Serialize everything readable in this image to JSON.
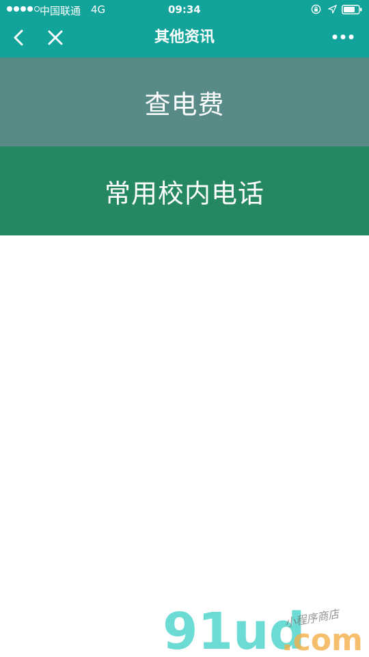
{
  "status_bar": {
    "carrier": "中国联通",
    "network": "4G",
    "time": "09:34"
  },
  "nav_bar": {
    "title": "其他资讯"
  },
  "menu": {
    "items": [
      {
        "label": "查电费",
        "color": "#588a88"
      },
      {
        "label": "常用校内电话",
        "color": "#258863"
      }
    ]
  },
  "watermark": {
    "brand": "91ud",
    "domain": ".com",
    "tagline": "小程序商店"
  },
  "colors": {
    "header": "#12a39a"
  }
}
